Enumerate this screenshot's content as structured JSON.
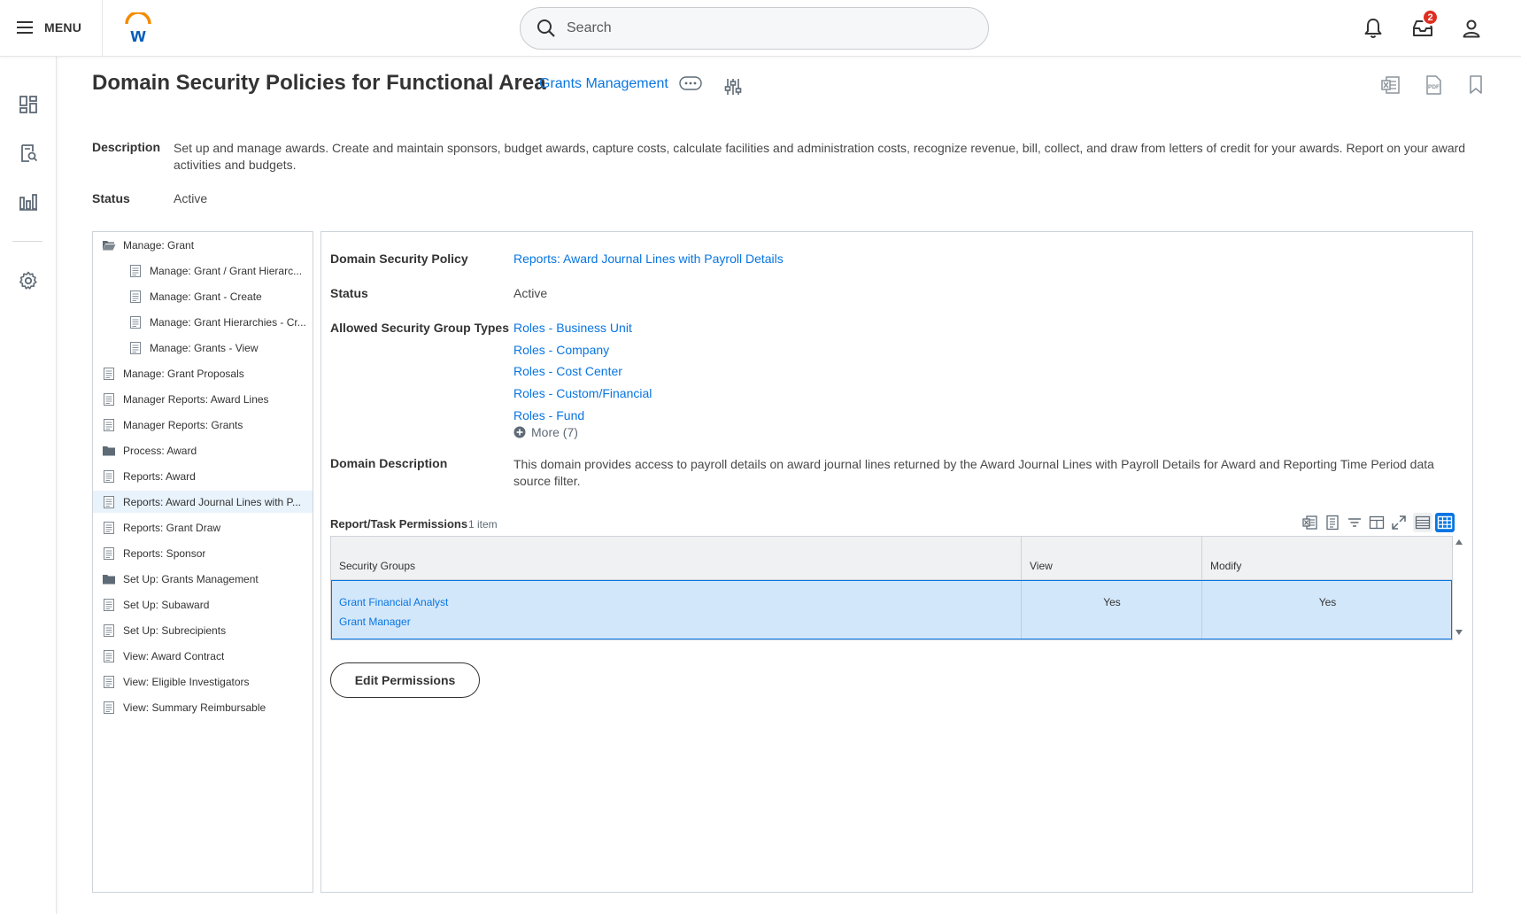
{
  "topbar": {
    "menu_label": "MENU",
    "search_placeholder": "Search",
    "inbox_badge": "2"
  },
  "header": {
    "title": "Domain Security Policies for Functional Area",
    "functional_area": "Grants Management"
  },
  "summary": {
    "description_label": "Description",
    "description": "Set up and manage awards. Create and maintain sponsors, budget awards, capture costs, calculate facilities and administration costs, recognize revenue, bill, collect, and draw from letters of credit for your awards. Report on your award activities and budgets.",
    "status_label": "Status",
    "status": "Active"
  },
  "tree": {
    "items": [
      {
        "label": "Manage: Grant",
        "type": "folder-open"
      },
      {
        "label": "Manage: Grant / Grant Hierarc...",
        "type": "doc"
      },
      {
        "label": "Manage: Grant - Create",
        "type": "doc"
      },
      {
        "label": "Manage: Grant Hierarchies - Cr...",
        "type": "doc"
      },
      {
        "label": "Manage: Grants - View",
        "type": "doc"
      },
      {
        "label": "Manage: Grant Proposals",
        "type": "doc"
      },
      {
        "label": "Manager Reports: Award Lines",
        "type": "doc"
      },
      {
        "label": "Manager Reports: Grants",
        "type": "doc"
      },
      {
        "label": "Process: Award",
        "type": "folder"
      },
      {
        "label": "Reports: Award",
        "type": "doc"
      },
      {
        "label": "Reports: Award Journal Lines with P...",
        "type": "doc"
      },
      {
        "label": "Reports: Grant Draw",
        "type": "doc"
      },
      {
        "label": "Reports: Sponsor",
        "type": "doc"
      },
      {
        "label": "Set Up: Grants Management",
        "type": "folder"
      },
      {
        "label": "Set Up: Subaward",
        "type": "doc"
      },
      {
        "label": "Set Up: Subrecipients",
        "type": "doc"
      },
      {
        "label": "View: Award Contract",
        "type": "doc"
      },
      {
        "label": "View: Eligible Investigators",
        "type": "doc"
      },
      {
        "label": "View: Summary Reimbursable",
        "type": "doc"
      }
    ],
    "selected_index": 10
  },
  "detail": {
    "policy_label": "Domain Security Policy",
    "policy": "Reports: Award Journal Lines with Payroll Details",
    "status_label": "Status",
    "status": "Active",
    "group_types_label": "Allowed Security Group Types",
    "group_types": [
      "Roles - Business Unit",
      "Roles - Company",
      "Roles - Cost Center",
      "Roles - Custom/Financial",
      "Roles - Fund"
    ],
    "more_label": "More (7)",
    "domain_desc_label": "Domain Description",
    "domain_desc": "This domain provides access to payroll details on award journal lines returned by the Award Journal Lines with Payroll Details for Award and Reporting Time Period data source filter."
  },
  "permissions": {
    "title": "Report/Task Permissions",
    "count": "1 item",
    "columns": [
      "Security Groups",
      "View",
      "Modify"
    ],
    "rows": [
      {
        "groups": [
          "Grant Financial Analyst",
          "Grant Manager"
        ],
        "view": "Yes",
        "modify": "Yes"
      }
    ],
    "edit_button": "Edit Permissions"
  },
  "colors": {
    "link": "#0875e1",
    "selected_row": "#d3e7fb",
    "badge": "#de2e21"
  }
}
